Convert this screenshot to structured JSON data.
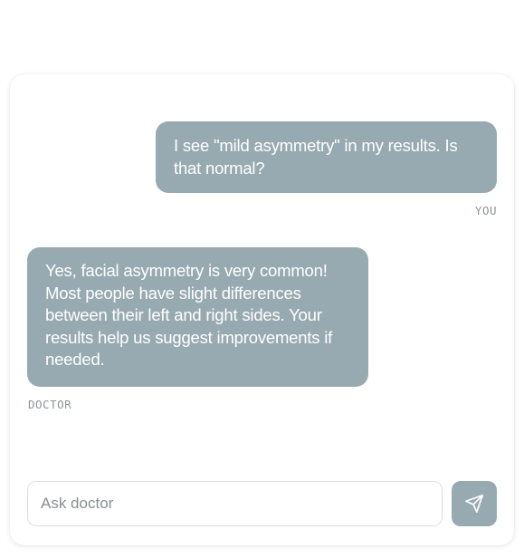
{
  "chat": {
    "messages": [
      {
        "role": "user",
        "text": "I see \"mild asymmetry\" in my results. Is that normal?",
        "sender_label": "YOU"
      },
      {
        "role": "doctor",
        "text": "Yes, facial asymmetry is very common! Most people have slight differences between their left and right sides. Your results help us suggest improvements if needed.",
        "sender_label": "DOCTOR"
      }
    ]
  },
  "composer": {
    "placeholder": "Ask doctor",
    "value": "",
    "send_icon": "send-icon"
  },
  "colors": {
    "bubble": "#98aab1",
    "label": "#8e9497",
    "input_border": "#dcdfe1"
  }
}
